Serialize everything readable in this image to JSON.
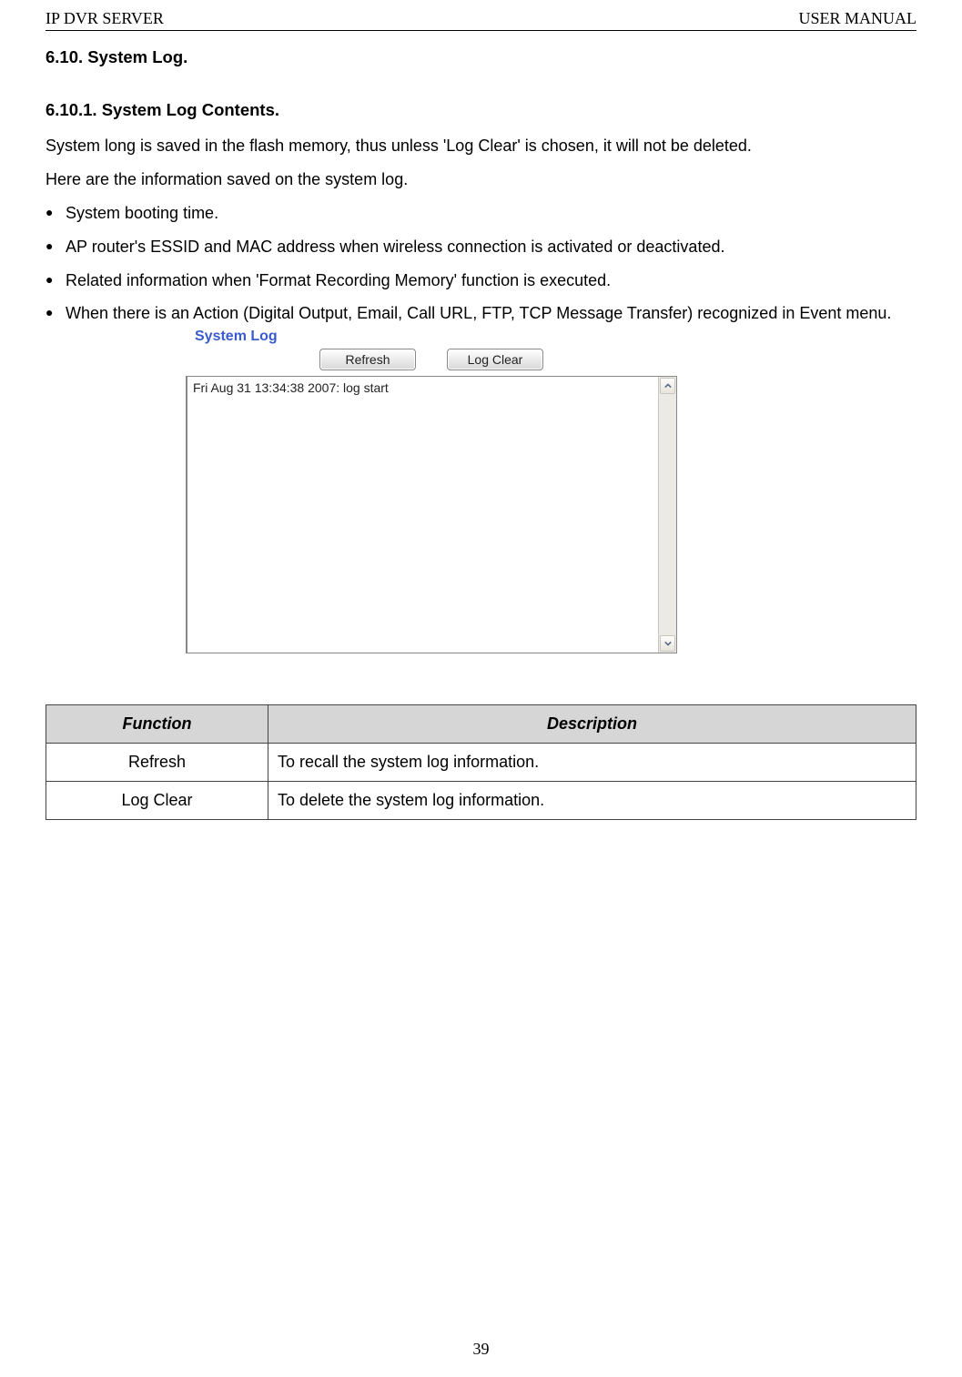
{
  "header": {
    "left": "IP DVR SERVER",
    "right": "USER MANUAL"
  },
  "section": {
    "number": "6.10.",
    "title": "System Log.",
    "sub_number": "6.10.1.",
    "sub_title": "System Log Contents."
  },
  "intro_lines": [
    "System long is saved in the flash memory, thus unless 'Log Clear' is chosen, it will not be deleted.",
    "Here are the information saved on the system log."
  ],
  "bullets": [
    "System booting time.",
    "AP router's ESSID and MAC address when wireless connection is activated or deactivated.",
    "Related information when 'Format Recording Memory' function is executed.",
    "When there is an Action (Digital Output, Email, Call URL, FTP, TCP Message Transfer) recognized in Event menu."
  ],
  "figure": {
    "title": "System Log",
    "refresh_label": "Refresh",
    "log_clear_label": "Log Clear",
    "log_entry": "Fri Aug 31 13:34:38 2007: log start"
  },
  "table": {
    "headers": {
      "func": "Function",
      "desc": "Description"
    },
    "rows": [
      {
        "func": "Refresh",
        "desc": "To recall the system log information."
      },
      {
        "func": "Log Clear",
        "desc": "To delete the system log information."
      }
    ]
  },
  "page_number": "39"
}
